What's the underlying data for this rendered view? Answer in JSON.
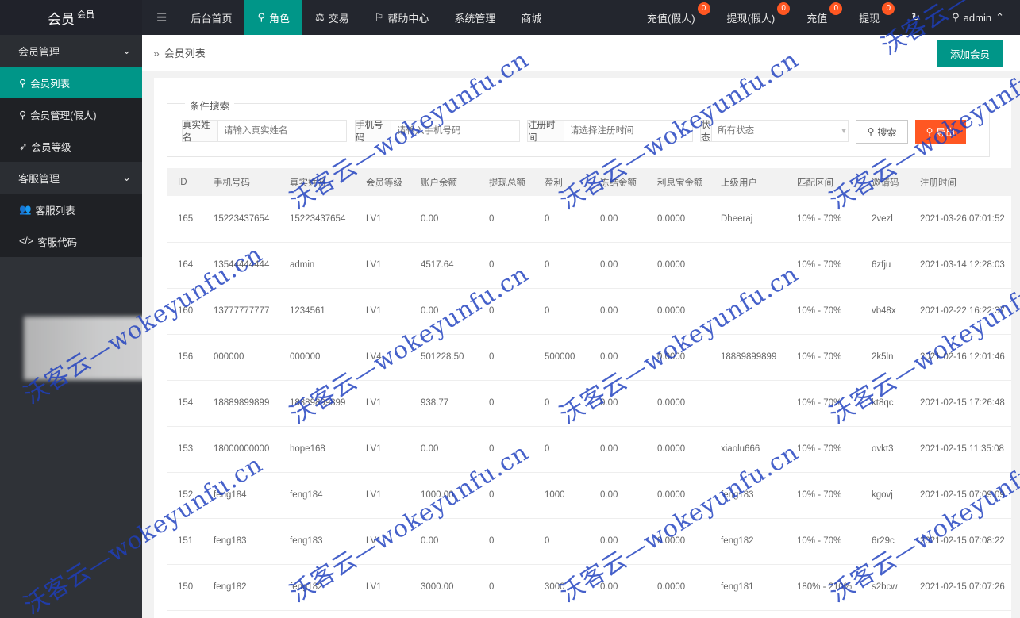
{
  "logo": {
    "title": "会员",
    "sup": "会员"
  },
  "nav": {
    "menu_icon": "hamburger-icon",
    "items": [
      {
        "label": "后台首页",
        "icon": ""
      },
      {
        "label": "角色",
        "icon": "user-icon"
      },
      {
        "label": "交易",
        "icon": "scale-icon"
      },
      {
        "label": "帮助中心",
        "icon": "flag-icon"
      },
      {
        "label": "系统管理",
        "icon": ""
      },
      {
        "label": "商城",
        "icon": ""
      }
    ],
    "right": [
      {
        "label": "充值(假人)",
        "badge": "0"
      },
      {
        "label": "提现(假人)",
        "badge": "0"
      },
      {
        "label": "充值",
        "badge": "0"
      },
      {
        "label": "提现",
        "badge": "0"
      }
    ],
    "refresh_icon": "refresh-icon",
    "user": "admin"
  },
  "sidebar": {
    "group1": "会员管理",
    "items1": [
      "会员列表",
      "会员管理(假人)",
      "会员等级"
    ],
    "group2": "客服管理",
    "items2": [
      "客服列表",
      "客服代码"
    ]
  },
  "breadcrumb": "会员列表",
  "add_button": "添加会员",
  "search": {
    "legend": "条件搜索",
    "name_label": "真实姓名",
    "name_placeholder": "请输入真实姓名",
    "phone_label": "手机号码",
    "phone_placeholder": "请输入手机号码",
    "time_label": "注册时间",
    "time_placeholder": "请选择注册时间",
    "status_label": "状态",
    "status_value": "所有状态",
    "search_button": "搜索",
    "export_button": "导出"
  },
  "table": {
    "headers": [
      "ID",
      "手机号码",
      "真实姓名",
      "会员等级",
      "账户余额",
      "提现总额",
      "盈利",
      "冻结金额",
      "利息宝金额",
      "上级用户",
      "匹配区间",
      "邀请码",
      "注册时间"
    ],
    "rows": [
      [
        "165",
        "15223437654",
        "15223437654",
        "LV1",
        "0.00",
        "0",
        "0",
        "0.00",
        "0.0000",
        "Dheeraj",
        "10% - 70%",
        "2vezl",
        "2021-03-26 07:01:52"
      ],
      [
        "164",
        "13544444444",
        "admin",
        "LV1",
        "4517.64",
        "0",
        "0",
        "0.00",
        "0.0000",
        "",
        "10% - 70%",
        "6zfju",
        "2021-03-14 12:28:03"
      ],
      [
        "160",
        "13777777777",
        "1234561",
        "LV1",
        "0.00",
        "0",
        "0",
        "0.00",
        "0.0000",
        "",
        "10% - 70%",
        "vb48x",
        "2021-02-22 16:22:37"
      ],
      [
        "156",
        "000000",
        "000000",
        "LV4",
        "501228.50",
        "0",
        "500000",
        "0.00",
        "0.0000",
        "18889899899",
        "10% - 70%",
        "2k5ln",
        "2021-02-16 12:01:46"
      ],
      [
        "154",
        "18889899899",
        "18889899899",
        "LV1",
        "938.77",
        "0",
        "0",
        "0.00",
        "0.0000",
        "",
        "10% - 70%",
        "kt8qc",
        "2021-02-15 17:26:48"
      ],
      [
        "153",
        "18000000000",
        "hope168",
        "LV1",
        "0.00",
        "0",
        "0",
        "0.00",
        "0.0000",
        "xiaolu666",
        "10% - 70%",
        "ovkt3",
        "2021-02-15 11:35:08"
      ],
      [
        "152",
        "feng184",
        "feng184",
        "LV1",
        "1000.00",
        "0",
        "1000",
        "0.00",
        "0.0000",
        "feng183",
        "10% - 70%",
        "kgovj",
        "2021-02-15 07:09:09"
      ],
      [
        "151",
        "feng183",
        "feng183",
        "LV1",
        "0.00",
        "0",
        "0",
        "0.00",
        "0.0000",
        "feng182",
        "10% - 70%",
        "6r29c",
        "2021-02-15 07:08:22"
      ],
      [
        "150",
        "feng182",
        "feng182",
        "LV1",
        "3000.00",
        "0",
        "3000",
        "0.00",
        "0.0000",
        "feng181",
        "180% - 210%",
        "s2bcw",
        "2021-02-15 07:07:26"
      ]
    ]
  },
  "watermark": "沃客云—wokeyunfu.cn"
}
